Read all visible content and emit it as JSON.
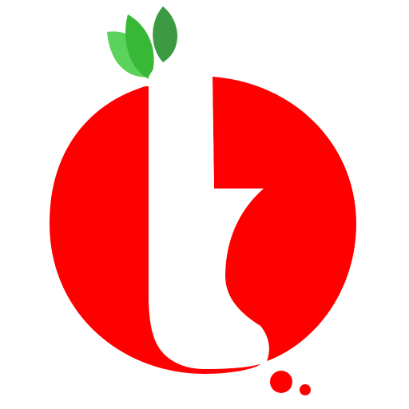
{
  "logo": {
    "icon": "tomato-t-logo-icon",
    "colors": {
      "background": "#ffffff",
      "tomato_red": "#fe0000",
      "letter_white": "#ffffff",
      "leaf_light": "#5bd25b",
      "leaf_mid": "#37b837",
      "leaf_dark": "#3b9a42",
      "dot_red": "#fe0000"
    }
  }
}
